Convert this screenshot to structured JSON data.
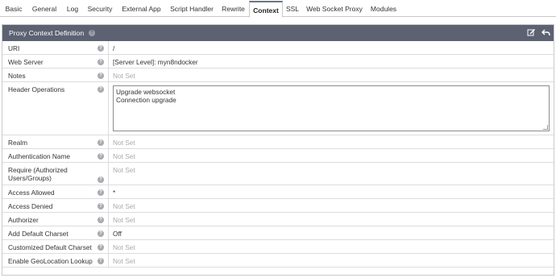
{
  "tabs": [
    {
      "label": "Basic"
    },
    {
      "label": "General"
    },
    {
      "label": "Log"
    },
    {
      "label": "Security"
    },
    {
      "label": "External App"
    },
    {
      "label": "Script Handler"
    },
    {
      "label": "Rewrite"
    },
    {
      "label": "Context",
      "active": true
    },
    {
      "label": "SSL"
    },
    {
      "label": "Web Socket Proxy"
    },
    {
      "label": "Modules"
    }
  ],
  "panel": {
    "title": "Proxy Context Definition",
    "help_icon": "question-circle-icon",
    "edit_icon": "edit-icon",
    "back_icon": "back-arrow-icon"
  },
  "rows": [
    {
      "label": "URI",
      "value": "/"
    },
    {
      "label": "Web Server",
      "value": "[Server Level]: myn8ndocker"
    },
    {
      "label": "Notes",
      "value": "Not Set"
    },
    {
      "label": "Header Operations",
      "value_lines": [
        "Upgrade websocket",
        "Connection upgrade"
      ]
    },
    {
      "label": "Realm",
      "value": "Not Set"
    },
    {
      "label": "Authentication Name",
      "value": "Not Set"
    },
    {
      "label": "Require (Authorized Users/Groups)",
      "value": "Not Set"
    },
    {
      "label": "Access Allowed",
      "value": "*"
    },
    {
      "label": "Access Denied",
      "value": "Not Set"
    },
    {
      "label": "Authorizer",
      "value": "Not Set"
    },
    {
      "label": "Add Default Charset",
      "value": "Off"
    },
    {
      "label": "Customized Default Charset",
      "value": "Not Set"
    },
    {
      "label": "Enable GeoLocation Lookup",
      "value": "Not Set"
    }
  ],
  "colors": {
    "header_bg": "#5c6272",
    "not_set_text": "#aaaaaa",
    "border": "#dddddd"
  }
}
